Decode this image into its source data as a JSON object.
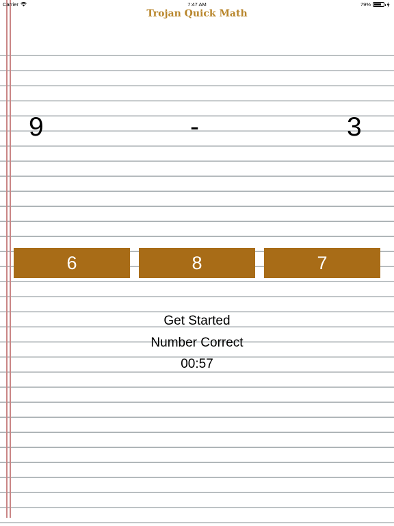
{
  "status_bar": {
    "carrier": "Carrier",
    "time": "7:47 AM",
    "battery_percent": "79%",
    "battery_level": 0.79
  },
  "app": {
    "title": "Trojan Quick Math"
  },
  "problem": {
    "left_operand": "9",
    "operator": "-",
    "right_operand": "3"
  },
  "answers": [
    {
      "label": "6"
    },
    {
      "label": "8"
    },
    {
      "label": "7"
    }
  ],
  "info": {
    "status_text": "Get Started",
    "score_label": "Number Correct",
    "timer": "00:57"
  },
  "colors": {
    "title": "#b8862c",
    "answer_button_bg": "#a86c17",
    "answer_button_text": "#ffffff",
    "rule_line": "#a7aeb1",
    "margin_line": "#c98585"
  }
}
